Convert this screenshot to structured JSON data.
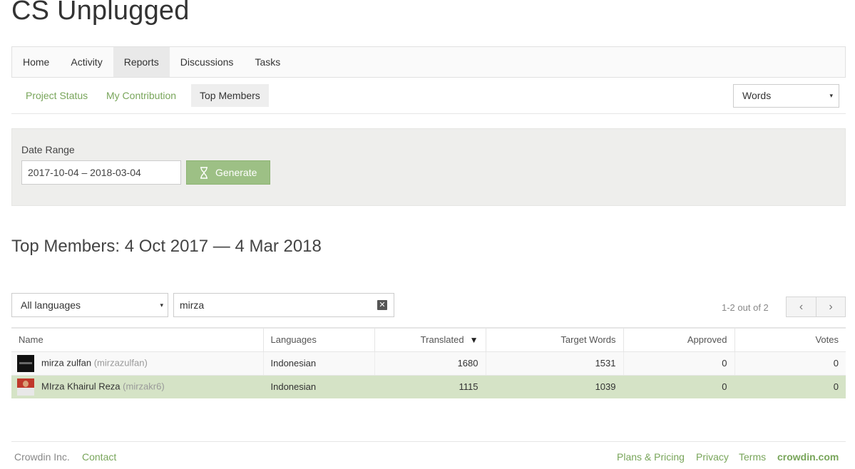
{
  "app": {
    "title": "CS Unplugged"
  },
  "main_nav": [
    {
      "label": "Home"
    },
    {
      "label": "Activity"
    },
    {
      "label": "Reports"
    },
    {
      "label": "Discussions"
    },
    {
      "label": "Tasks"
    }
  ],
  "sub_nav": [
    {
      "label": "Project Status"
    },
    {
      "label": "My Contribution"
    },
    {
      "label": "Top Members"
    }
  ],
  "metric_select": {
    "value": "Words",
    "caret": "▾"
  },
  "filter": {
    "label": "Date Range",
    "date_value": "2017-10-04 – 2018-03-04",
    "generate_label": "Generate"
  },
  "section": {
    "title": "Top Members: 4 Oct 2017 — 4 Mar 2018"
  },
  "table_controls": {
    "language_value": "All languages",
    "language_caret": "▾",
    "search_value": "mirza",
    "clear_glyph": "✕",
    "pager_info": "1-2 out of 2",
    "prev_glyph": "‹",
    "next_glyph": "›"
  },
  "table": {
    "columns": [
      "Name",
      "Languages",
      "Translated",
      "Target Words",
      "Approved",
      "Votes"
    ],
    "sort_glyph": "▼",
    "rows": [
      {
        "name": "mirza zulfan",
        "username": "(mirzazulfan)",
        "language": "Indonesian",
        "translated": "1680",
        "target_words": "1531",
        "approved": "0",
        "votes": "0"
      },
      {
        "name": "MIrza Khairul Reza",
        "username": "(mirzakr6)",
        "language": "Indonesian",
        "translated": "1115",
        "target_words": "1039",
        "approved": "0",
        "votes": "0"
      }
    ]
  },
  "footer": {
    "company": "Crowdin Inc.",
    "contact": "Contact",
    "plans": "Plans & Pricing",
    "privacy": "Privacy",
    "terms": "Terms",
    "brand": "crowdin.com"
  },
  "colors": {
    "accent_green": "#78a55a",
    "button_green": "#9dc085",
    "highlight_row": "#d5e3c6",
    "panel_bg": "#eeeeec"
  }
}
